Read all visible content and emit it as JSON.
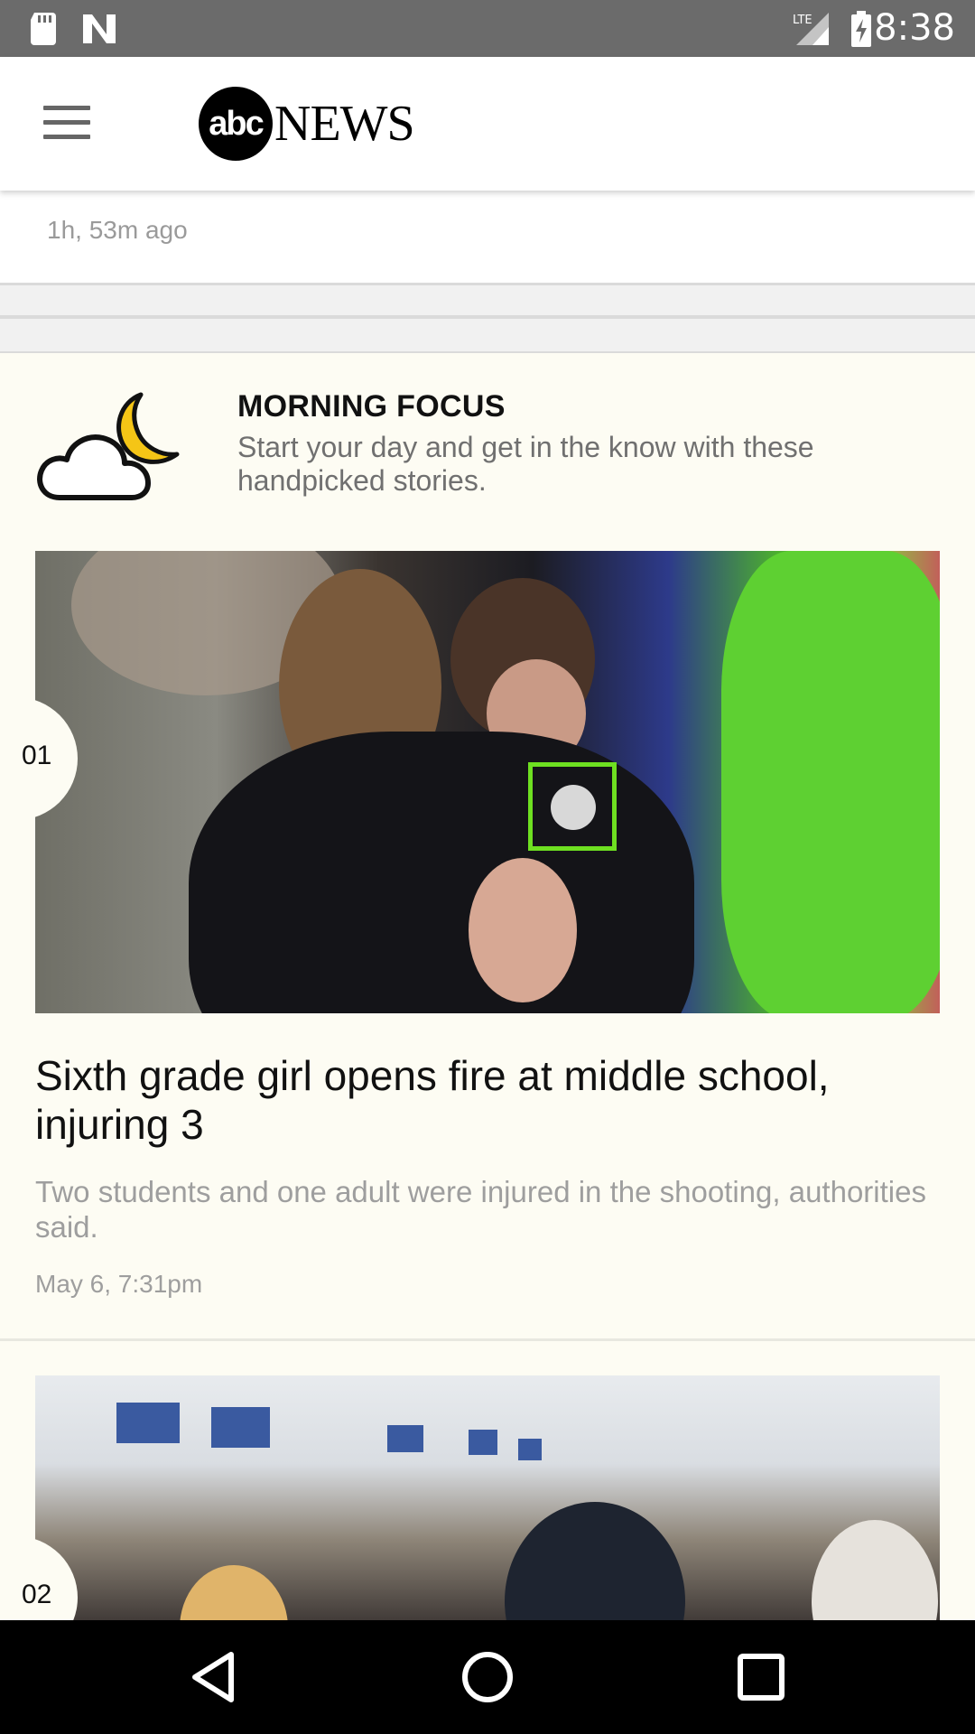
{
  "status_bar": {
    "time": "8:38",
    "network": "LTE"
  },
  "header": {
    "logo_abc": "abc",
    "logo_news": "NEWS"
  },
  "previous_item": {
    "time_ago": "1h, 53m ago"
  },
  "morning_focus": {
    "title": "MORNING FOCUS",
    "subtitle": "Start your day and get in the know with these handpicked stories."
  },
  "stories": [
    {
      "number": "01",
      "headline": "Sixth grade girl opens fire at middle school, injuring 3",
      "summary": "Two students and one adult were injured in the shooting, authorities said.",
      "date": "May 6, 7:31pm"
    },
    {
      "number": "02"
    }
  ],
  "colors": {
    "focus_bg": "#fdfcf3",
    "moon": "#f5c516",
    "status_bar": "#6b6b6b"
  }
}
